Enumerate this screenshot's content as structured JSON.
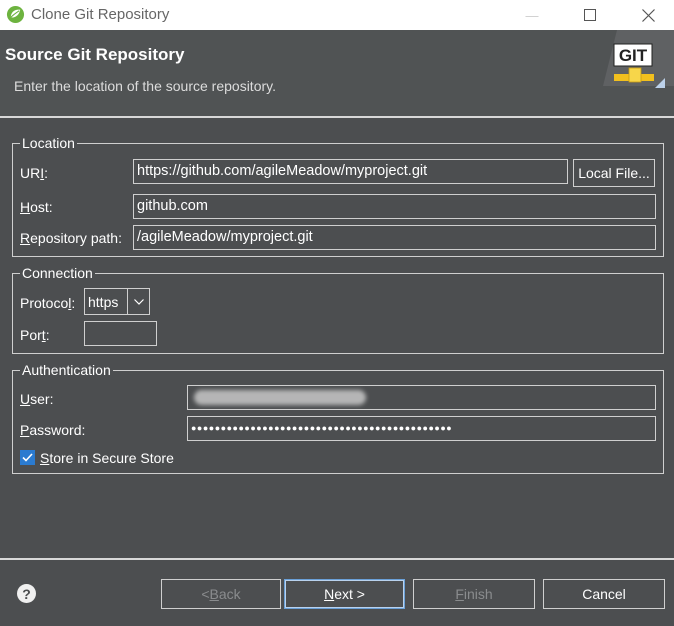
{
  "window": {
    "title": "Clone Git Repository",
    "minimize_glyph": "—",
    "icons": {
      "app": "spring-leaf-icon",
      "git": "git-logo-icon",
      "help": "help-icon"
    }
  },
  "header": {
    "title": "Source Git Repository",
    "description": "Enter the location of the source repository.",
    "git_logo_text": "GIT"
  },
  "location": {
    "legend": "Location",
    "uri_label_pre": "UR",
    "uri_label_mn": "I",
    "uri_label_post": ":",
    "uri_value": "https://github.com/agileMeadow/myproject.git",
    "local_file_label": "Local File...",
    "host_label_mn": "H",
    "host_label_post": "ost:",
    "host_value": "github.com",
    "repo_label_mn": "R",
    "repo_label_post": "epository path:",
    "repo_value": "/agileMeadow/myproject.git"
  },
  "connection": {
    "legend": "Connection",
    "protocol_label_pre": "Protoco",
    "protocol_label_mn": "l",
    "protocol_label_post": ":",
    "protocol_value": "https",
    "port_label_pre": "Por",
    "port_label_mn": "t",
    "port_label_post": ":",
    "port_value": ""
  },
  "authentication": {
    "legend": "Authentication",
    "user_label_mn": "U",
    "user_label_post": "ser:",
    "user_value": "",
    "password_label_mn": "P",
    "password_label_post": "assword:",
    "password_value": "●●●●●●●●●●●●●●●●●●●●●●●●●●●●●●●●●●●●●●●●●●●●",
    "store_label_mn": "S",
    "store_label_post": "tore in Secure Store",
    "store_checked": true
  },
  "buttons": {
    "help": "?",
    "back_pre": "< ",
    "back_mn": "B",
    "back_post": "ack",
    "next_mn": "N",
    "next_post": "ext >",
    "finish_mn": "F",
    "finish_post": "inish",
    "cancel": "Cancel"
  },
  "colors": {
    "background": "#4c4e50",
    "accent": "#2b7bd0",
    "disabled_text": "#8a8c8e"
  }
}
